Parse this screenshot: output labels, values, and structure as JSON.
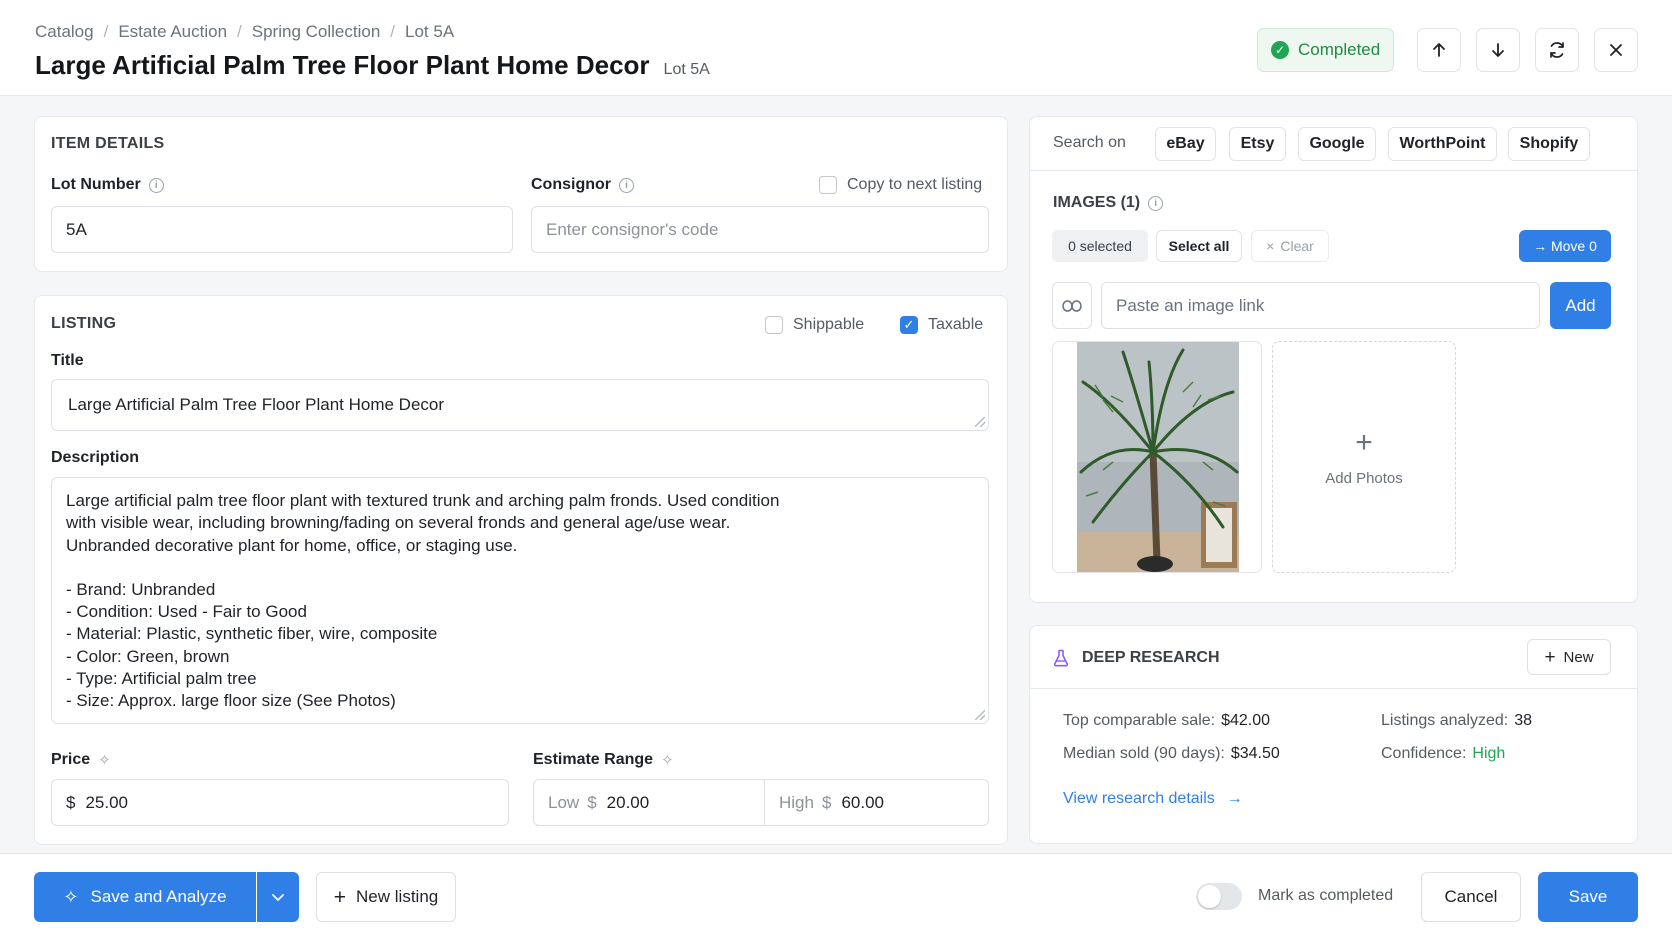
{
  "breadcrumb": [
    "Catalog",
    "Estate Auction",
    "Spring Collection",
    "Lot 5A"
  ],
  "title": "Large Artificial Palm Tree Floor Plant Home Decor",
  "lot_tag": "Lot 5A",
  "status": "Completed",
  "item_details": {
    "heading": "ITEM DETAILS",
    "lot_number_label": "Lot Number",
    "lot_number_value": "5A",
    "consignor_label": "Consignor",
    "consignor_placeholder": "Enter consignor's code",
    "copy_label": "Copy to next listing"
  },
  "listing": {
    "heading": "LISTING",
    "shippable_label": "Shippable",
    "shippable_checked": false,
    "taxable_label": "Taxable",
    "taxable_checked": true,
    "title_label": "Title",
    "title_value": "Large Artificial Palm Tree Floor Plant Home Decor",
    "description_label": "Description",
    "description_lines": [
      "Large artificial palm tree floor plant with textured trunk and arching palm fronds. Used condition",
      "with visible wear, including browning/fading on several fronds and general age/use wear.",
      "Unbranded decorative plant for home, office, or staging use.",
      "",
      "- Brand: Unbranded",
      "- Condition: Used - Fair to Good",
      "- Material: Plastic, synthetic fiber, wire, composite",
      "- Color: Green, brown",
      "- Type: Artificial palm tree",
      "- Size: Approx. large floor size (See Photos)"
    ],
    "price_label": "Price",
    "currency": "$",
    "price_value": "25.00",
    "estimate_label": "Estimate Range",
    "low_label": "Low",
    "low_value": "20.00",
    "high_label": "High",
    "high_value": "60.00"
  },
  "search": {
    "label": "Search on",
    "sites": [
      "eBay",
      "Etsy",
      "Google",
      "WorthPoint",
      "Shopify"
    ]
  },
  "images": {
    "heading": "IMAGES (1)",
    "selected": "0 selected",
    "select_all": "Select all",
    "clear": "Clear",
    "move": "→ Move 0",
    "link_placeholder": "Paste an image link",
    "add": "Add",
    "add_photos": "Add Photos"
  },
  "research": {
    "heading": "DEEP RESEARCH",
    "new": "New",
    "top_sale_label": "Top comparable sale:",
    "top_sale_value": "$42.00",
    "median_label": "Median sold (90 days):",
    "median_value": "$34.50",
    "listings_label": "Listings analyzed:",
    "listings_value": "38",
    "confidence_label": "Confidence:",
    "confidence_value": "High",
    "details_link": "View research details"
  },
  "footer": {
    "save_analyze": "Save and Analyze",
    "new_listing": "New listing",
    "mark_completed": "Mark as completed",
    "cancel": "Cancel",
    "save": "Save"
  },
  "colors": {
    "accent": "#2f7fe6",
    "success": "#22a455",
    "research_icon": "#8b5cf6"
  }
}
